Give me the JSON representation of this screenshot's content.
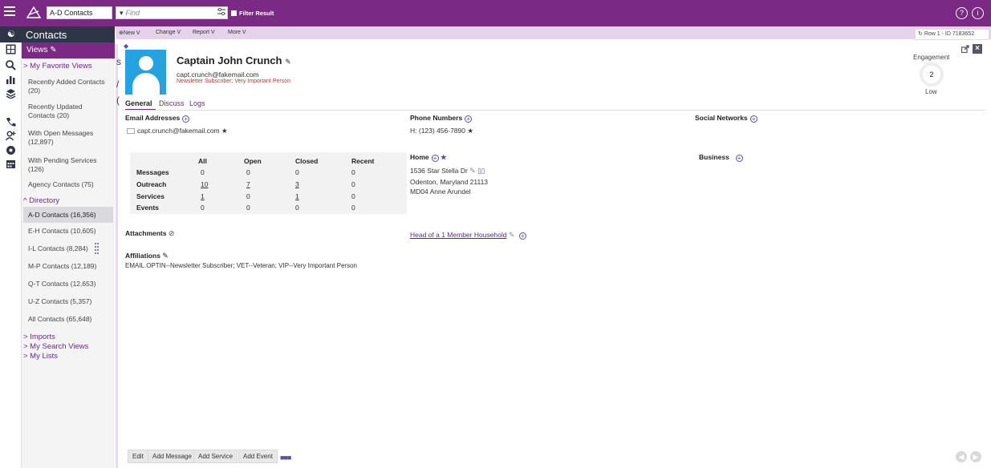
{
  "topbar": {
    "view_select": "A-D Contacts",
    "find_placeholder": "Find",
    "filter_result": "Filter Result",
    "help_glyph": "?",
    "info_glyph": "i"
  },
  "sidebar": {
    "module_title": "Contacts",
    "views_label": "Views",
    "my_favorite_views": "> My Favorite Views",
    "items": [
      {
        "label": "Recently Added Contacts",
        "count": "(20)"
      },
      {
        "label": "Recently Updated",
        "count": "Contacts (20)"
      },
      {
        "label": "With Open Messages",
        "count": "(12,897)"
      },
      {
        "label": "With Pending Services",
        "count": "(126)"
      },
      {
        "label": "Agency Contacts (75)"
      }
    ],
    "directory_label": "^ Directory",
    "directory_items": [
      "A-D Contacts (16,356)",
      "E-H Contacts (10,605)",
      "I-L Contacts (8,284)",
      "M-P Contacts (12,189)",
      "Q-T Contacts (12,653)",
      "U-Z Contacts (5,357)",
      "All Contacts (65,648)"
    ],
    "imports": "> Imports",
    "my_search_views": "> My Search Views",
    "my_lists": "> My Lists"
  },
  "toolbar": {
    "new": "New V",
    "change": "Change V",
    "report": "Report V",
    "more": "More V",
    "record_id": "Row 1 - ID 7183652"
  },
  "contact": {
    "name": "Captain John Crunch",
    "email": "capt.crunch@fakemail.com",
    "tags": "Newsletter Subscriber; Very Important Person"
  },
  "tabs": [
    "General",
    "Discuss",
    "Logs"
  ],
  "engagement": {
    "label": "Engagement",
    "value": "2",
    "level": "Low"
  },
  "sections": {
    "email_addresses": {
      "title": "Email Addresses",
      "value": "capt.crunch@fakemail.com"
    },
    "phone_numbers": {
      "title": "Phone Numbers",
      "value": "H: (123) 456-7890"
    },
    "social_networks": {
      "title": "Social Networks"
    },
    "home": {
      "title": "Home",
      "line1": "1536 Star Stella Dr",
      "line2": "Odenton, Maryland 21113",
      "line3": "MD04 Anne Arundel"
    },
    "business": {
      "title": "Business"
    },
    "attachments": {
      "title": "Attachments"
    },
    "household": {
      "label": "Head of a 1 Member Household"
    },
    "affiliations": {
      "title": "Affiliations",
      "value": "EMAIL.OPTIN--Newsletter Subscriber; VET--Veteran; VIP--Very Important Person"
    }
  },
  "stats": {
    "headers": [
      "All",
      "Open",
      "Closed",
      "Recent"
    ],
    "rows": [
      {
        "label": "Messages",
        "values": [
          "0",
          "0",
          "0",
          "0"
        ]
      },
      {
        "label": "Outreach",
        "values": [
          "10",
          "7",
          "3",
          "0"
        ]
      },
      {
        "label": "Services",
        "values": [
          "1",
          "0",
          "1",
          "0"
        ]
      },
      {
        "label": "Events",
        "values": [
          "0",
          "0",
          "0",
          "0"
        ]
      }
    ]
  },
  "bottom_buttons": [
    "Edit",
    "Add Message",
    "Add Service",
    "Add Event"
  ],
  "colors": {
    "brand_purple": "#7a2a82",
    "toolbar_lavender": "#e4d3ea",
    "sidebar_dark": "#2e3547",
    "avatar_blue": "#24a3e0",
    "tag_red": "#c0392b"
  }
}
